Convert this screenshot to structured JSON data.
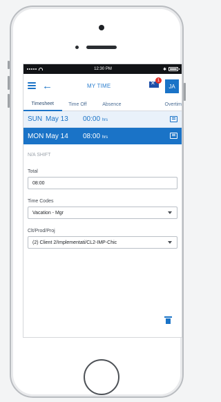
{
  "status_bar": {
    "time": "12:30 PM",
    "bluetooth": "✱",
    "battery_level": 1.0
  },
  "app": {
    "title": "MY TIME",
    "notification_count": "1",
    "avatar_initials": "JA"
  },
  "tabs": [
    "Timesheet",
    "Time Off",
    "Absence",
    "Overtim"
  ],
  "days": [
    {
      "dow": "SUN",
      "date": "May 13",
      "hours": "00:00",
      "unit": "hrs"
    },
    {
      "dow": "MON",
      "date": "May 14",
      "hours": "08:00",
      "unit": "hrs"
    }
  ],
  "detail": {
    "shift_text": "N/A SHIFT",
    "total_label": "Total",
    "total_value": "08:00",
    "time_codes_label": "Time Codes",
    "time_codes_value": "Vacation - Mgr",
    "project_label": "Clt/Prod/Proj",
    "project_value": "(2) Client 2/Implementati/CL2-IMP-Chic"
  },
  "colors": {
    "accent": "#1a73c7",
    "badge": "#e0312b",
    "title": "#2d7fcf"
  },
  "icons": [
    "hamburger-icon",
    "back-arrow-icon",
    "message-icon",
    "note-icon",
    "dropdown-caret-icon",
    "trash-icon"
  ]
}
